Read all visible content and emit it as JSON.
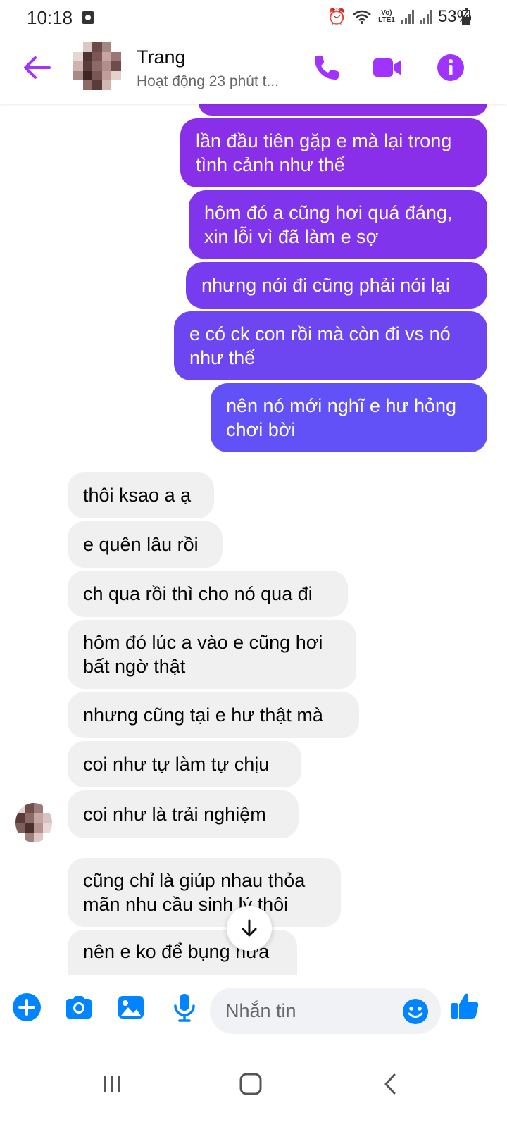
{
  "status_bar": {
    "time": "10:18",
    "network_label": "Vo) LTE1",
    "battery": "53%"
  },
  "header": {
    "contact_name": "Trang",
    "activity": "Hoạt động 23 phút t..."
  },
  "colors": {
    "accent": "#a033ff",
    "bubble_top": "#8a2be2",
    "bubble_bottom": "#5d5cf7",
    "incoming_bubble": "#f0f0f0"
  },
  "messages": {
    "outgoing": [
      {
        "text": ""
      },
      {
        "text": "lần đầu tiên gặp e mà lại trong tình cảnh như thế"
      },
      {
        "text": "hôm đó a cũng hơi quá đáng, xin lỗi vì đã làm e sợ"
      },
      {
        "text": "nhưng nói đi cũng phải nói lại"
      },
      {
        "text": "e có ck con rồi mà còn đi vs nó như thế"
      },
      {
        "text": "nên nó mới nghĩ e hư hỏng chơi bời"
      }
    ],
    "incoming": [
      {
        "text": "thôi ksao a ạ"
      },
      {
        "text": "e quên lâu rồi"
      },
      {
        "text": "ch qua rồi thì cho nó qua đi"
      },
      {
        "text": "hôm đó lúc a vào e cũng hơi bất ngờ thật"
      },
      {
        "text": "nhưng cũng tại e hư thật mà"
      },
      {
        "text": "coi như tự làm tự chịu"
      },
      {
        "text": "coi như là trải nghiệm"
      },
      {
        "text": "cũng chỉ là giúp nhau thỏa mãn nhu cầu sinh lý thôi"
      },
      {
        "text": "nên e ko để bụng nữa"
      }
    ]
  },
  "composer": {
    "placeholder": "Nhắn tin"
  },
  "icons": {
    "back": "arrow-left-icon",
    "call": "phone-icon",
    "video": "video-camera-icon",
    "info": "info-icon",
    "plus": "plus-icon",
    "camera": "camera-icon",
    "gallery": "image-icon",
    "mic": "microphone-icon",
    "emoji": "emoji-icon",
    "like": "thumbs-up-icon",
    "scroll": "arrow-down-icon"
  }
}
